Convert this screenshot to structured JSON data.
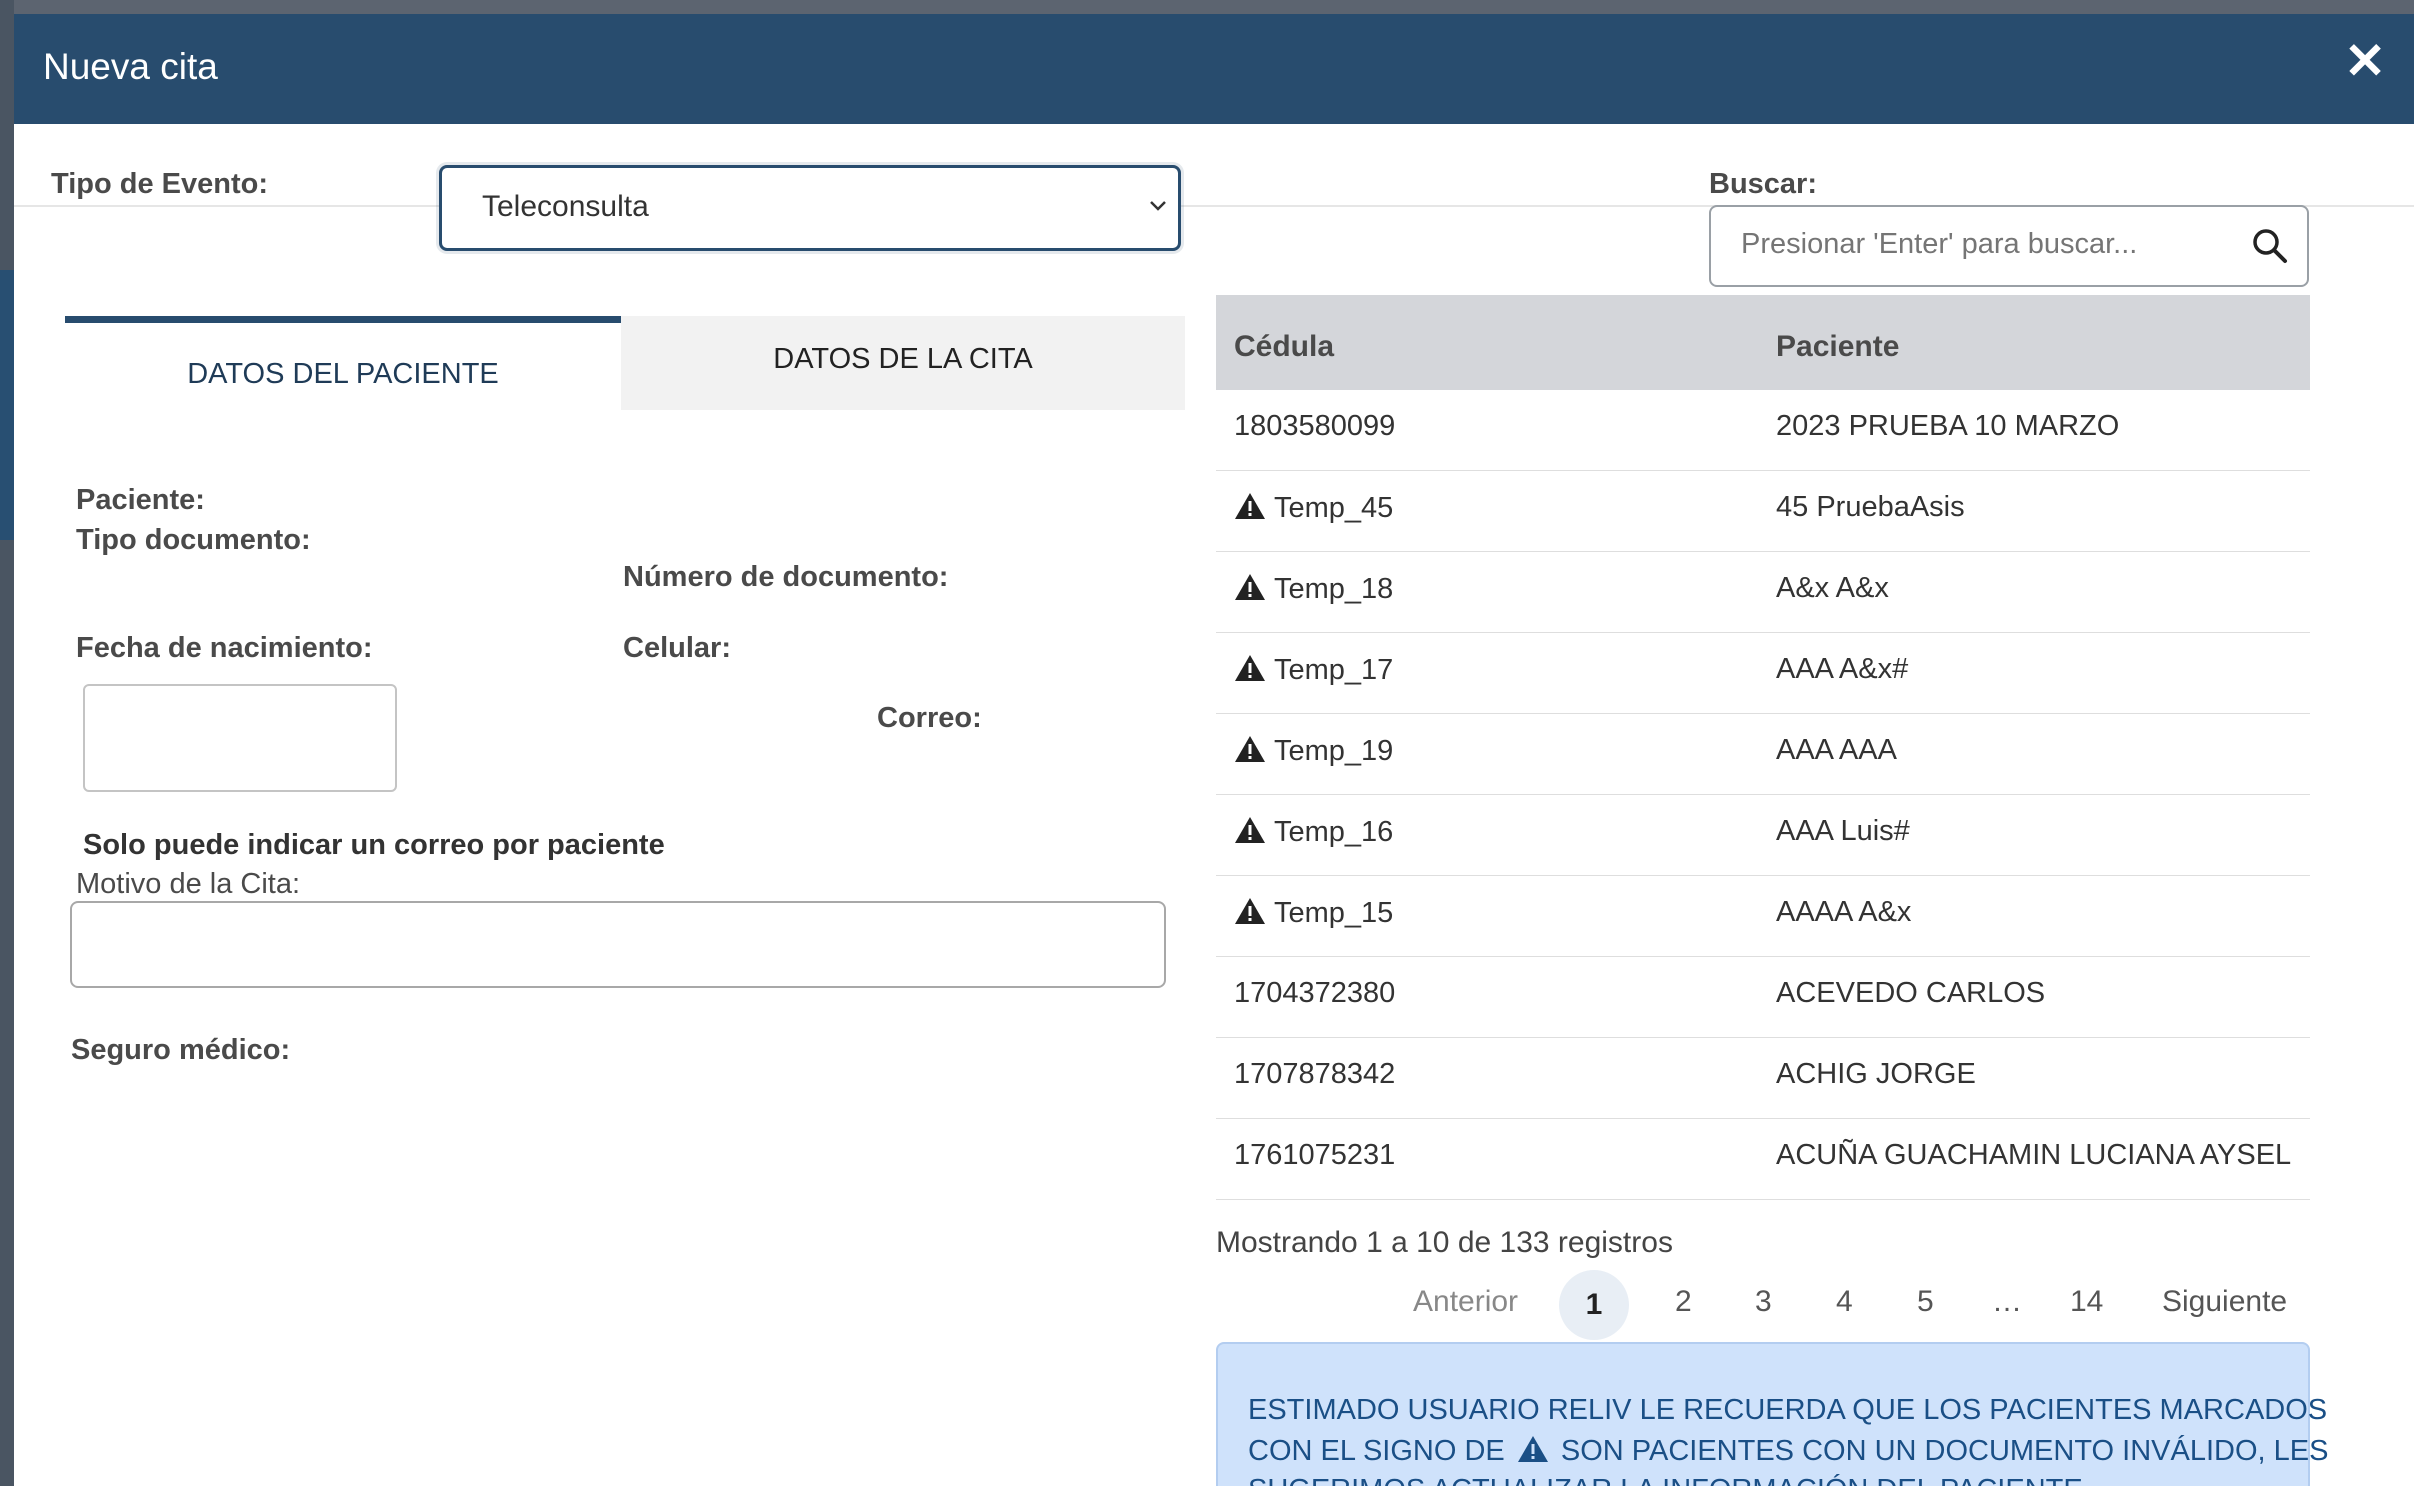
{
  "modal": {
    "title": "Nueva cita",
    "close_glyph": "✕"
  },
  "event_type": {
    "label": "Tipo de Evento:",
    "selected": "Teleconsulta"
  },
  "search": {
    "label": "Buscar:",
    "placeholder": "Presionar 'Enter' para buscar..."
  },
  "tabs": [
    {
      "label": "DATOS DEL PACIENTE"
    },
    {
      "label": "DATOS DE LA CITA"
    }
  ],
  "form": {
    "paciente_label": "Paciente:",
    "tipo_doc_label": "Tipo documento:",
    "num_doc_label": "Número de documento:",
    "fecha_nac_label": "Fecha de nacimiento:",
    "celular_label": "Celular:",
    "correo_label": "Correo:",
    "correo_note": "Solo puede indicar un correo por paciente",
    "motivo_label": "Motivo de la Cita:",
    "seguro_label": "Seguro médico:"
  },
  "table": {
    "headers": [
      "Cédula",
      "Paciente"
    ],
    "rows": [
      {
        "cedula": "1803580099",
        "paciente": "2023 PRUEBA 10 MARZO",
        "warning": false
      },
      {
        "cedula": "Temp_45",
        "paciente": "45 PruebaAsis",
        "warning": true
      },
      {
        "cedula": "Temp_18",
        "paciente": "A&x A&x",
        "warning": true
      },
      {
        "cedula": "Temp_17",
        "paciente": "AAA A&x#",
        "warning": true
      },
      {
        "cedula": "Temp_19",
        "paciente": "AAA AAA",
        "warning": true
      },
      {
        "cedula": "Temp_16",
        "paciente": "AAA Luis#",
        "warning": true
      },
      {
        "cedula": "Temp_15",
        "paciente": "AAAA A&x",
        "warning": true
      },
      {
        "cedula": "1704372380",
        "paciente": "ACEVEDO CARLOS",
        "warning": false
      },
      {
        "cedula": "1707878342",
        "paciente": "ACHIG JORGE",
        "warning": false
      },
      {
        "cedula": "1761075231",
        "paciente": "ACUÑA GUACHAMIN LUCIANA AYSEL",
        "warning": false
      }
    ]
  },
  "pagination": {
    "info": "Mostrando 1 a 10 de 133 registros",
    "prev": "Anterior",
    "pages": [
      "1",
      "2",
      "3",
      "4",
      "5",
      "…",
      "14"
    ],
    "next": "Siguiente",
    "current": "1"
  },
  "alert": {
    "line1": "ESTIMADO USUARIO RELIV LE RECUERDA QUE LOS PACIENTES MARCADOS",
    "line2a": "CON EL SIGNO DE",
    "line2b": "SON PACIENTES CON UN DOCUMENTO INVÁLIDO, LES",
    "line3": "SUGERIMOS ACTUALIZAR LA INFORMACIÓN DEL PACIENTE"
  },
  "colors": {
    "header": "#284c6e",
    "alert_bg": "#cfe2fb",
    "alert_text": "#1a4f86",
    "table_head": "#d4d6da"
  },
  "icons": {
    "close": "close-icon",
    "search": "search-icon",
    "select": "chevron-down-icon",
    "warning": "warning-icon"
  }
}
